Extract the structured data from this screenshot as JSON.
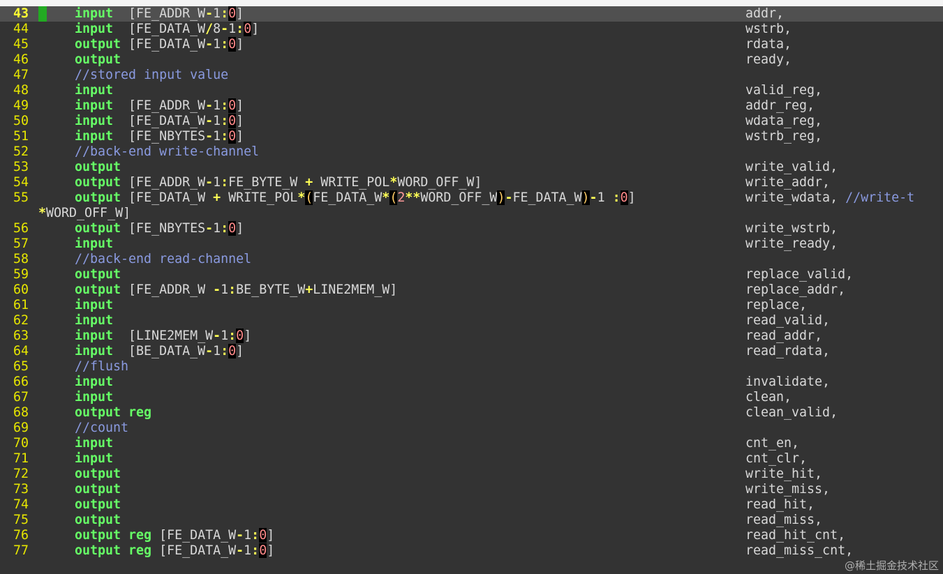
{
  "lines": [
    {
      "num": "43",
      "code": "input  [FE_ADDR_W-1:0]",
      "name": "addr,",
      "current": true
    },
    {
      "num": "44",
      "code": "input  [FE_DATA_W/8-1:0]",
      "name": "wstrb,"
    },
    {
      "num": "45",
      "code": "output [FE_DATA_W-1:0]",
      "name": "rdata,"
    },
    {
      "num": "46",
      "code": "output",
      "name": "ready,"
    },
    {
      "num": "47",
      "code": "//stored input value",
      "name": ""
    },
    {
      "num": "48",
      "code": "input",
      "name": "valid_reg,"
    },
    {
      "num": "49",
      "code": "input  [FE_ADDR_W-1:0]",
      "name": "addr_reg,"
    },
    {
      "num": "50",
      "code": "input  [FE_DATA_W-1:0]",
      "name": "wdata_reg,"
    },
    {
      "num": "51",
      "code": "input  [FE_NBYTES-1:0]",
      "name": "wstrb_reg,"
    },
    {
      "num": "52",
      "code": "//back-end write-channel",
      "name": ""
    },
    {
      "num": "53",
      "code": "output",
      "name": "write_valid,"
    },
    {
      "num": "54",
      "code": "output [FE_ADDR_W-1:FE_BYTE_W + WRITE_POL*WORD_OFF_W]",
      "name": "write_addr,"
    },
    {
      "num": "55",
      "code": "output [FE_DATA_W + WRITE_POL*(FE_DATA_W*(2**WORD_OFF_W)-FE_DATA_W)-1 :0]",
      "name": "write_wdata, //write-t"
    },
    {
      "num": "",
      "code": "*WORD_OFF_W]",
      "name": "",
      "wrapped": true
    },
    {
      "num": "56",
      "code": "output [FE_NBYTES-1:0]",
      "name": "write_wstrb,"
    },
    {
      "num": "57",
      "code": "input",
      "name": "write_ready,"
    },
    {
      "num": "58",
      "code": "//back-end read-channel",
      "name": ""
    },
    {
      "num": "59",
      "code": "output",
      "name": "replace_valid,"
    },
    {
      "num": "60",
      "code": "output [FE_ADDR_W -1:BE_BYTE_W+LINE2MEM_W]",
      "name": "replace_addr,"
    },
    {
      "num": "61",
      "code": "input",
      "name": "replace,"
    },
    {
      "num": "62",
      "code": "input",
      "name": "read_valid,"
    },
    {
      "num": "63",
      "code": "input  [LINE2MEM_W-1:0]",
      "name": "read_addr,"
    },
    {
      "num": "64",
      "code": "input  [BE_DATA_W-1:0]",
      "name": "read_rdata,"
    },
    {
      "num": "65",
      "code": "//flush",
      "name": ""
    },
    {
      "num": "66",
      "code": "input",
      "name": "invalidate,"
    },
    {
      "num": "67",
      "code": "input",
      "name": "clean,"
    },
    {
      "num": "68",
      "code": "output reg",
      "name": "clean_valid,"
    },
    {
      "num": "69",
      "code": "//count",
      "name": ""
    },
    {
      "num": "70",
      "code": "input",
      "name": "cnt_en,"
    },
    {
      "num": "71",
      "code": "input",
      "name": "cnt_clr,"
    },
    {
      "num": "72",
      "code": "output",
      "name": "write_hit,"
    },
    {
      "num": "73",
      "code": "output",
      "name": "write_miss,"
    },
    {
      "num": "74",
      "code": "output",
      "name": "read_hit,"
    },
    {
      "num": "75",
      "code": "output",
      "name": "read_miss,"
    },
    {
      "num": "76",
      "code": "output reg [FE_DATA_W-1:0]",
      "name": "read_hit_cnt,"
    },
    {
      "num": "77",
      "code": "output reg [FE_DATA_W-1:0]",
      "name": "read_miss_cnt,"
    }
  ],
  "watermark": "@稀土掘金技术社区",
  "colors": {
    "background": "#333333",
    "line_number": "#e6e600",
    "keyword": "#66ff66",
    "comment": "#8a9ae0",
    "operator": "#ffff55"
  }
}
